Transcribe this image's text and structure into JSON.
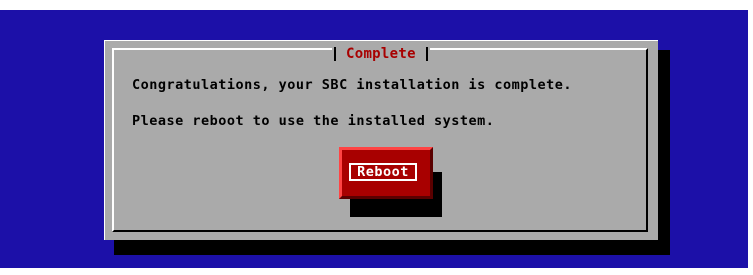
{
  "dialog": {
    "title": "Complete",
    "message_line1": "Congratulations, your SBC installation is complete.",
    "message_line2": "Please reboot to use the installed system.",
    "reboot_button_label": "Reboot"
  },
  "colors": {
    "background": "#1c10a8",
    "dialog": "#aaaaaa",
    "title_text": "#a80000",
    "button": "#a80000",
    "button_text": "#ffffff"
  }
}
